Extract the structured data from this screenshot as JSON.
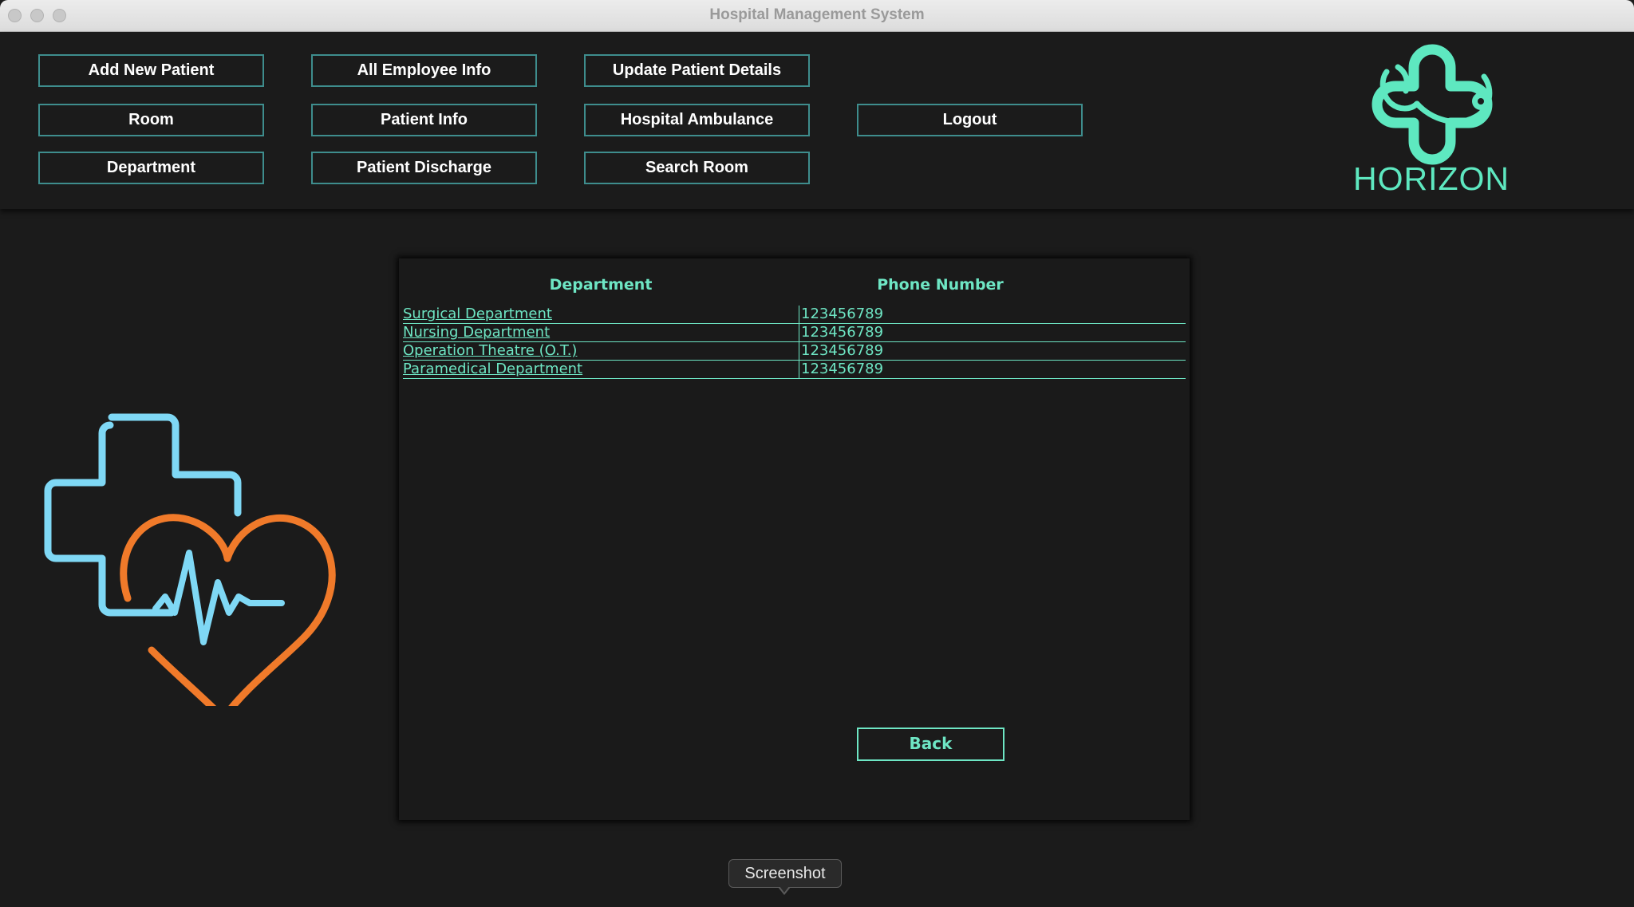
{
  "window": {
    "title": "Hospital Management System"
  },
  "nav": {
    "add_new_patient": "Add New Patient",
    "all_employee_info": "All Employee Info",
    "update_patient_details": "Update Patient Details",
    "room": "Room",
    "patient_info": "Patient Info",
    "hospital_ambulance": "Hospital Ambulance",
    "logout": "Logout",
    "department": "Department",
    "patient_discharge": "Patient Discharge",
    "search_room": "Search Room"
  },
  "logo": {
    "text": "HORIZON",
    "icon": "medical-cross-stethoscope-icon",
    "color": "#5ee8c0"
  },
  "decor": {
    "icon": "neon-cross-heartbeat-icon",
    "cross_color": "#7fd8f5",
    "heart_color": "#f07a2a"
  },
  "table": {
    "headers": [
      "Department",
      "Phone Number"
    ],
    "rows": [
      {
        "department": "Surgical Department",
        "phone": "123456789"
      },
      {
        "department": "Nursing Department",
        "phone": "123456789"
      },
      {
        "department": "Operation Theatre (O.T.)",
        "phone": "123456789"
      },
      {
        "department": "Paramedical Department",
        "phone": "123456789"
      }
    ],
    "accent": "#6ee6c4"
  },
  "back_label": "Back",
  "tooltip": {
    "text": "Screenshot"
  },
  "colors": {
    "background": "#1b1b1b",
    "button_border": "#3e8d8d"
  }
}
